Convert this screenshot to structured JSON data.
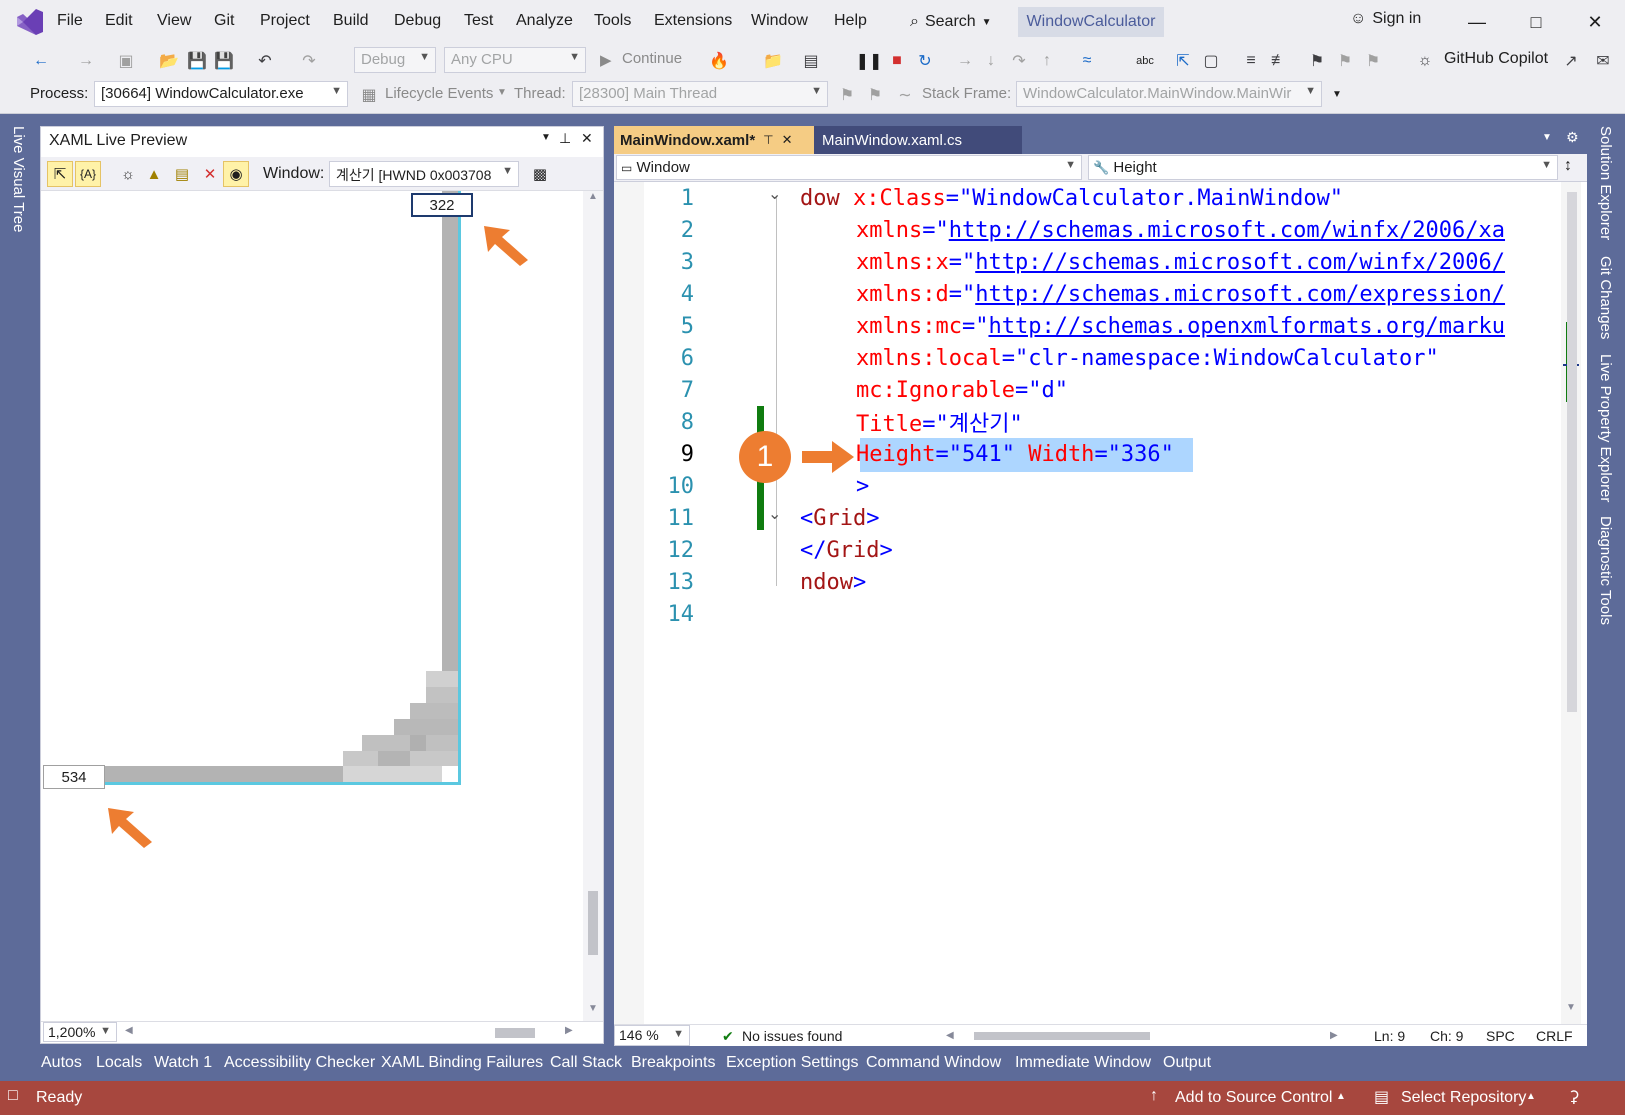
{
  "menu": [
    "File",
    "Edit",
    "View",
    "Git",
    "Project",
    "Build",
    "Debug",
    "Test",
    "Analyze",
    "Tools",
    "Extensions",
    "Window",
    "Help"
  ],
  "search_label": "Search",
  "title_tab": "WindowCalculator",
  "sign_in": "Sign in",
  "toolbar": {
    "config": "Debug",
    "platform": "Any CPU",
    "continue": "Continue",
    "copilot": "GitHub Copilot",
    "process_label": "Process:",
    "process_value": "[30664] WindowCalculator.exe",
    "lifecycle": "Lifecycle Events",
    "thread_label": "Thread:",
    "thread_value": "[28300] Main Thread",
    "stack_label": "Stack Frame:",
    "stack_value": "WindowCalculator.MainWindow.MainWir"
  },
  "left_rail": {
    "live_visual_tree": "Live Visual Tree"
  },
  "right_rail": [
    "Solution Explorer",
    "Git Changes",
    "Live Property Explorer",
    "Diagnostic Tools"
  ],
  "preview": {
    "title": "XAML Live Preview",
    "window_label": "Window:",
    "window_value": "계산기 [HWND 0x003708",
    "width_readout": "322",
    "height_readout": "534",
    "zoom": "1,200%"
  },
  "editor": {
    "tab_active": "MainWindow.xaml*",
    "tab_inactive": "MainWindow.xaml.cs",
    "nav_left": "Window",
    "nav_right": "Height",
    "badge": "1",
    "lines": [
      {
        "num": "1",
        "parts": [
          {
            "t": "dow ",
            "c": "tk-el"
          },
          {
            "t": "x:Class",
            "c": "tk-attr"
          },
          {
            "t": "=\"WindowCalculator.MainWindow\"",
            "c": "tk-val"
          }
        ]
      },
      {
        "num": "2",
        "parts": [
          {
            "t": "xmlns",
            "c": "tk-attr"
          },
          {
            "t": "=\"",
            "c": "tk-val"
          },
          {
            "t": "http://schemas.microsoft.com/winfx/2006/xa",
            "c": "tk-url"
          }
        ]
      },
      {
        "num": "3",
        "parts": [
          {
            "t": "xmlns:x",
            "c": "tk-attr"
          },
          {
            "t": "=\"",
            "c": "tk-val"
          },
          {
            "t": "http://schemas.microsoft.com/winfx/2006/",
            "c": "tk-url"
          }
        ]
      },
      {
        "num": "4",
        "parts": [
          {
            "t": "xmlns:d",
            "c": "tk-attr"
          },
          {
            "t": "=\"",
            "c": "tk-val"
          },
          {
            "t": "http://schemas.microsoft.com/expression/",
            "c": "tk-url"
          }
        ]
      },
      {
        "num": "5",
        "parts": [
          {
            "t": "xmlns:mc",
            "c": "tk-attr"
          },
          {
            "t": "=\"",
            "c": "tk-val"
          },
          {
            "t": "http://schemas.openxmlformats.org/marku",
            "c": "tk-url"
          }
        ]
      },
      {
        "num": "6",
        "parts": [
          {
            "t": "xmlns:local",
            "c": "tk-attr"
          },
          {
            "t": "=\"clr-namespace:WindowCalculator\"",
            "c": "tk-val"
          }
        ]
      },
      {
        "num": "7",
        "parts": [
          {
            "t": "mc:Ignorable",
            "c": "tk-attr"
          },
          {
            "t": "=\"d\"",
            "c": "tk-val"
          }
        ]
      },
      {
        "num": "8",
        "parts": [
          {
            "t": "Title",
            "c": "tk-attr"
          },
          {
            "t": "=\"계산기\"",
            "c": "tk-val"
          }
        ]
      },
      {
        "num": "9",
        "parts": [
          {
            "t": "Height",
            "c": "tk-attr"
          },
          {
            "t": "=\"541\" ",
            "c": "tk-val"
          },
          {
            "t": "Width",
            "c": "tk-attr"
          },
          {
            "t": "=\"336\"",
            "c": "tk-val"
          }
        ]
      },
      {
        "num": "10",
        "parts": [
          {
            "t": ">",
            "c": "tk-punct"
          }
        ]
      },
      {
        "num": "11",
        "parts": [
          {
            "t": "<",
            "c": "tk-punct"
          },
          {
            "t": "Grid",
            "c": "tk-el"
          },
          {
            "t": ">",
            "c": "tk-punct"
          }
        ]
      },
      {
        "num": "12",
        "parts": [
          {
            "t": "</",
            "c": "tk-punct"
          },
          {
            "t": "Grid",
            "c": "tk-el"
          },
          {
            "t": ">",
            "c": "tk-punct"
          }
        ]
      },
      {
        "num": "13",
        "parts": [
          {
            "t": "ndow",
            "c": "tk-el"
          },
          {
            "t": ">",
            "c": "tk-punct"
          }
        ]
      },
      {
        "num": "14",
        "parts": []
      }
    ]
  },
  "editor_status": {
    "zoom": "146 %",
    "issues": "No issues found",
    "ln": "Ln: 9",
    "ch": "Ch: 9",
    "spc": "SPC",
    "crlf": "CRLF"
  },
  "tool_tabs": [
    "Autos",
    "Locals",
    "Watch 1",
    "Accessibility Checker",
    "XAML Binding Failures",
    "Call Stack",
    "Breakpoints",
    "Exception Settings",
    "Command Window",
    "Immediate Window",
    "Output"
  ],
  "statusbar": {
    "ready": "Ready",
    "source_control": "Add to Source Control",
    "repository": "Select Repository"
  },
  "colors": {
    "accent_orange": "#ed7d31",
    "status_bar": "#a7473e",
    "dock_background": "#5d6b99",
    "active_tab": "#f5cc84"
  }
}
